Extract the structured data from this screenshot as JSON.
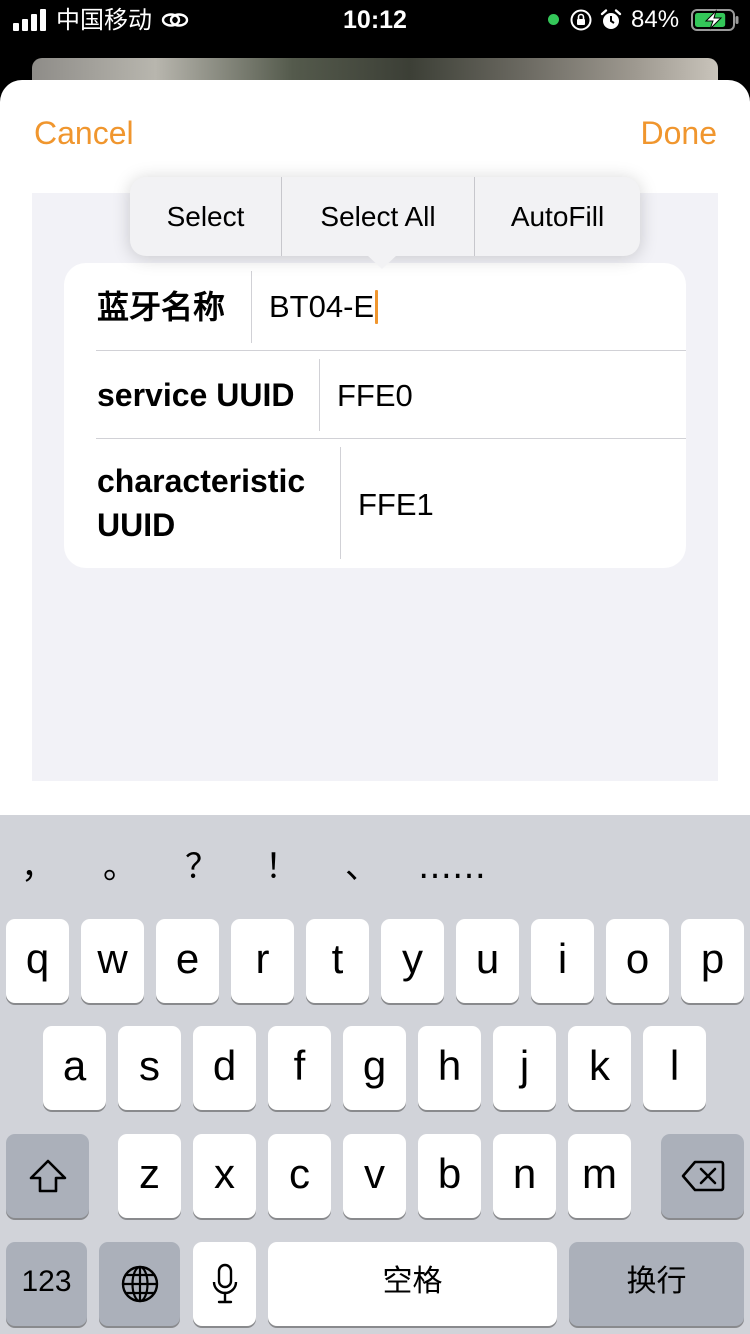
{
  "status_bar": {
    "carrier": "中国移动",
    "time": "10:12",
    "battery_percent": "84%",
    "battery_level": 0.84,
    "icons": [
      "signal-icon",
      "link-icon",
      "mic-indicator-dot",
      "orientation-lock-icon",
      "alarm-icon",
      "battery-charging-icon"
    ]
  },
  "nav": {
    "cancel_label": "Cancel",
    "done_label": "Done"
  },
  "edit_menu": {
    "items": [
      "Select",
      "Select All",
      "AutoFill"
    ]
  },
  "form": {
    "rows": [
      {
        "label": "蓝牙名称",
        "value": "BT04-E"
      },
      {
        "label": "service UUID",
        "value": "FFE0"
      },
      {
        "label_line1": "characteristic",
        "label_line2": "UUID",
        "value": "FFE1"
      }
    ]
  },
  "keyboard": {
    "punctuation": [
      "，",
      "。",
      "？",
      "！",
      "、",
      "……"
    ],
    "row1": [
      "q",
      "w",
      "e",
      "r",
      "t",
      "y",
      "u",
      "i",
      "o",
      "p"
    ],
    "row2": [
      "a",
      "s",
      "d",
      "f",
      "g",
      "h",
      "j",
      "k",
      "l"
    ],
    "row3": [
      "z",
      "x",
      "c",
      "v",
      "b",
      "n",
      "m"
    ],
    "numbers_label": "123",
    "space_label": "空格",
    "return_label": "换行",
    "special_icons": [
      "shift-icon",
      "delete-icon",
      "globe-icon",
      "mic-icon"
    ]
  },
  "colors": {
    "accent": "#f0962e",
    "keyboard_bg": "#d1d3d9",
    "content_bg": "#f2f2f7"
  }
}
